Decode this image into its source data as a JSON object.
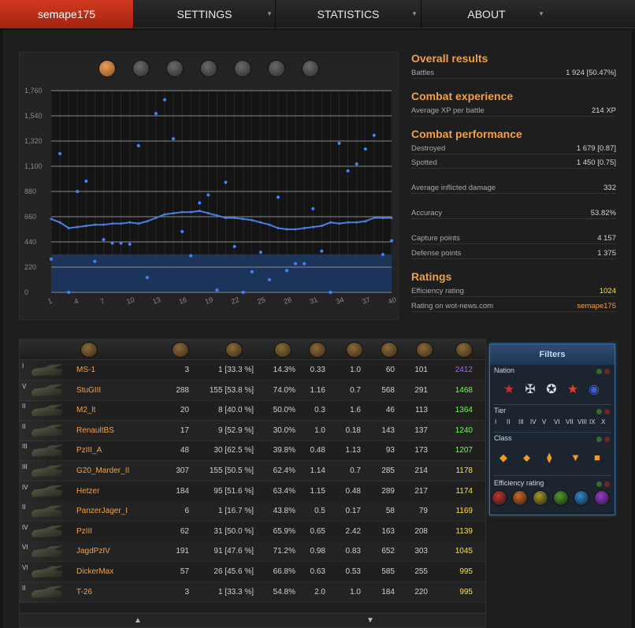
{
  "nav": {
    "tabs": [
      {
        "label": "semape175",
        "active": true
      },
      {
        "label": "SETTINGS",
        "dropdown": true
      },
      {
        "label": "STATISTICS",
        "dropdown": true
      },
      {
        "label": "ABOUT",
        "dropdown": true
      }
    ],
    "dropdown_glyph": "▾"
  },
  "chart_filter_icons": [
    "all-tanks-icon",
    "star-icon",
    "tank-top-icon",
    "circle-icon",
    "shell-icon",
    "crossed-swords-icon",
    "tank-side-icon"
  ],
  "chart_data": {
    "type": "scatter",
    "x_ticks": [
      1,
      4,
      7,
      10,
      13,
      16,
      19,
      22,
      25,
      28,
      31,
      34,
      37,
      40
    ],
    "y_ticks": [
      "0",
      "220",
      "440",
      "660",
      "880",
      "1,100",
      "1,320",
      "1,540",
      "1,760"
    ],
    "ylim": [
      0,
      1760
    ],
    "xlim": [
      1,
      40
    ],
    "band_value": 332,
    "points": [
      [
        1,
        290
      ],
      [
        2,
        1210
      ],
      [
        3,
        0
      ],
      [
        4,
        880
      ],
      [
        5,
        970
      ],
      [
        6,
        270
      ],
      [
        7,
        460
      ],
      [
        8,
        430
      ],
      [
        9,
        430
      ],
      [
        10,
        420
      ],
      [
        11,
        1280
      ],
      [
        12,
        130
      ],
      [
        13,
        1560
      ],
      [
        14,
        1680
      ],
      [
        15,
        1340
      ],
      [
        16,
        530
      ],
      [
        17,
        320
      ],
      [
        18,
        780
      ],
      [
        19,
        850
      ],
      [
        20,
        20
      ],
      [
        21,
        960
      ],
      [
        22,
        400
      ],
      [
        23,
        0
      ],
      [
        24,
        180
      ],
      [
        25,
        350
      ],
      [
        26,
        110
      ],
      [
        27,
        830
      ],
      [
        28,
        190
      ],
      [
        29,
        250
      ],
      [
        30,
        250
      ],
      [
        31,
        730
      ],
      [
        32,
        360
      ],
      [
        33,
        0
      ],
      [
        34,
        1300
      ],
      [
        35,
        1060
      ],
      [
        36,
        1120
      ],
      [
        37,
        1250
      ],
      [
        38,
        1370
      ],
      [
        39,
        330
      ],
      [
        40,
        450
      ]
    ],
    "average_line": [
      [
        1,
        640
      ],
      [
        2,
        610
      ],
      [
        3,
        560
      ],
      [
        4,
        570
      ],
      [
        5,
        580
      ],
      [
        6,
        590
      ],
      [
        7,
        590
      ],
      [
        8,
        600
      ],
      [
        9,
        600
      ],
      [
        10,
        610
      ],
      [
        11,
        600
      ],
      [
        12,
        620
      ],
      [
        13,
        650
      ],
      [
        14,
        680
      ],
      [
        15,
        690
      ],
      [
        16,
        700
      ],
      [
        17,
        700
      ],
      [
        18,
        710
      ],
      [
        19,
        690
      ],
      [
        20,
        670
      ],
      [
        21,
        650
      ],
      [
        22,
        650
      ],
      [
        23,
        640
      ],
      [
        24,
        630
      ],
      [
        25,
        610
      ],
      [
        26,
        590
      ],
      [
        27,
        560
      ],
      [
        28,
        550
      ],
      [
        29,
        550
      ],
      [
        30,
        560
      ],
      [
        31,
        570
      ],
      [
        32,
        580
      ],
      [
        33,
        610
      ],
      [
        34,
        600
      ],
      [
        35,
        610
      ],
      [
        36,
        610
      ],
      [
        37,
        620
      ],
      [
        38,
        650
      ],
      [
        39,
        650
      ],
      [
        40,
        650
      ]
    ],
    "colors": {
      "points": "#3e86ff",
      "line": "#4a7fe0",
      "band": "#1d3a66"
    }
  },
  "stats": {
    "overall": {
      "heading": "Overall results",
      "rows": [
        {
          "label": "Battles",
          "value": "1 924 [50.47%]"
        }
      ]
    },
    "experience": {
      "heading": "Combat experience",
      "rows": [
        {
          "label": "Average XP per battle",
          "value": "214 XP"
        }
      ]
    },
    "performance": {
      "heading": "Combat performance",
      "rows": [
        {
          "label": "Destroyed",
          "value": "1 679 [0.87]"
        },
        {
          "label": "Spotted",
          "value": "1 450 [0.75]"
        },
        {
          "label": "Average inflicted damage",
          "value": "332"
        },
        {
          "label": "Accuracy",
          "value": "53.82%"
        },
        {
          "label": "Capture points",
          "value": "4 157"
        },
        {
          "label": "Defense points",
          "value": "1 375"
        }
      ]
    },
    "ratings": {
      "heading": "Ratings",
      "rows": [
        {
          "label": "Efficiency rating",
          "value": "1024"
        },
        {
          "label": "Rating on wot-news.com",
          "value": "semape175"
        }
      ]
    }
  },
  "table": {
    "header_icons": [
      "tank-icon",
      "battles-icon",
      "victories-icon",
      "win-rate-icon",
      "destroyed-icon",
      "damage-icon",
      "spotted-icon",
      "xp-icon",
      "efficiency-icon"
    ],
    "rows": [
      {
        "tier": "I",
        "name": "MS-1",
        "battles": "3",
        "wins": "1 [33.3 %]",
        "pct": "14.3%",
        "kills": "0.33",
        "spot": "1.0",
        "dmg": "60",
        "xp": "101",
        "eff": "2412",
        "eff_color": "#b55cff"
      },
      {
        "tier": "V",
        "name": "StuGIII",
        "battles": "288",
        "wins": "155 [53.8 %]",
        "pct": "74.0%",
        "kills": "1.16",
        "spot": "0.7",
        "dmg": "568",
        "xp": "291",
        "eff": "1468",
        "eff_color": "#6cff4a"
      },
      {
        "tier": "II",
        "name": "M2_lt",
        "battles": "20",
        "wins": "8 [40.0 %]",
        "pct": "50.0%",
        "kills": "0.3",
        "spot": "1.6",
        "dmg": "46",
        "xp": "113",
        "eff": "1364",
        "eff_color": "#6cff4a"
      },
      {
        "tier": "II",
        "name": "RenaultBS",
        "battles": "17",
        "wins": "9 [52.9 %]",
        "pct": "30.0%",
        "kills": "1.0",
        "spot": "0.18",
        "dmg": "143",
        "xp": "137",
        "eff": "1240",
        "eff_color": "#6cff4a"
      },
      {
        "tier": "III",
        "name": "PzIII_A",
        "battles": "48",
        "wins": "30 [62.5 %]",
        "pct": "39.8%",
        "kills": "0.48",
        "spot": "1.13",
        "dmg": "93",
        "xp": "173",
        "eff": "1207",
        "eff_color": "#6cff4a"
      },
      {
        "tier": "III",
        "name": "G20_Marder_II",
        "battles": "307",
        "wins": "155 [50.5 %]",
        "pct": "62.4%",
        "kills": "1.14",
        "spot": "0.7",
        "dmg": "285",
        "xp": "214",
        "eff": "1178",
        "eff_color": "#ffe03a"
      },
      {
        "tier": "IV",
        "name": "Hetzer",
        "battles": "184",
        "wins": "95 [51.6 %]",
        "pct": "63.4%",
        "kills": "1.15",
        "spot": "0.48",
        "dmg": "289",
        "xp": "217",
        "eff": "1174",
        "eff_color": "#ffe03a"
      },
      {
        "tier": "II",
        "name": "PanzerJager_I",
        "battles": "6",
        "wins": "1 [16.7 %]",
        "pct": "43.8%",
        "kills": "0.5",
        "spot": "0.17",
        "dmg": "58",
        "xp": "79",
        "eff": "1169",
        "eff_color": "#ffe03a"
      },
      {
        "tier": "IV",
        "name": "PzIII",
        "battles": "62",
        "wins": "31 [50.0 %]",
        "pct": "65.9%",
        "kills": "0.65",
        "spot": "2.42",
        "dmg": "163",
        "xp": "208",
        "eff": "1139",
        "eff_color": "#ffe03a"
      },
      {
        "tier": "VI",
        "name": "JagdPzIV",
        "battles": "191",
        "wins": "91 [47.6 %]",
        "pct": "71.2%",
        "kills": "0.98",
        "spot": "0.83",
        "dmg": "652",
        "xp": "303",
        "eff": "1045",
        "eff_color": "#ffe03a"
      },
      {
        "tier": "VI",
        "name": "DickerMax",
        "battles": "57",
        "wins": "26 [45.6 %]",
        "pct": "66.8%",
        "kills": "0.63",
        "spot": "0.53",
        "dmg": "585",
        "xp": "255",
        "eff": "995",
        "eff_color": "#ffe03a"
      },
      {
        "tier": "II",
        "name": "T-26",
        "battles": "3",
        "wins": "1 [33.3 %]",
        "pct": "54.8%",
        "kills": "2.0",
        "spot": "1.0",
        "dmg": "184",
        "xp": "220",
        "eff": "995",
        "eff_color": "#ffe03a"
      }
    ]
  },
  "scroll": {
    "up": "▲",
    "down": "▼"
  },
  "filters": {
    "title": "Filters",
    "nation_label": "Nation",
    "nations": [
      {
        "icon": "ussr-star-icon",
        "glyph": "★",
        "color": "#c4302a"
      },
      {
        "icon": "germany-cross-icon",
        "glyph": "✠",
        "color": "#d8d8d8"
      },
      {
        "icon": "usa-star-icon",
        "glyph": "✪",
        "color": "#e0e0e0"
      },
      {
        "icon": "china-star-icon",
        "glyph": "★",
        "color": "#e0402a"
      },
      {
        "icon": "france-roundel-icon",
        "glyph": "◉",
        "color": "#3a5fd0"
      }
    ],
    "tier_label": "Tier",
    "tiers": [
      "I",
      "II",
      "III",
      "IV",
      "V",
      "VI",
      "VII",
      "VIII",
      "IX",
      "X"
    ],
    "class_label": "Class",
    "classes": [
      {
        "icon": "light-tank-icon",
        "glyph": "◆"
      },
      {
        "icon": "medium-tank-icon",
        "glyph": "⬥"
      },
      {
        "icon": "heavy-tank-icon",
        "glyph": "⧫"
      },
      {
        "icon": "td-icon",
        "glyph": "▼"
      },
      {
        "icon": "spg-icon",
        "glyph": "■"
      }
    ],
    "eff_label": "Efficiency rating",
    "eff_colors": [
      "#c0342a",
      "#d06a22",
      "#a59a2a",
      "#4aa02a",
      "#2a8ad0",
      "#9a3ad0"
    ]
  }
}
